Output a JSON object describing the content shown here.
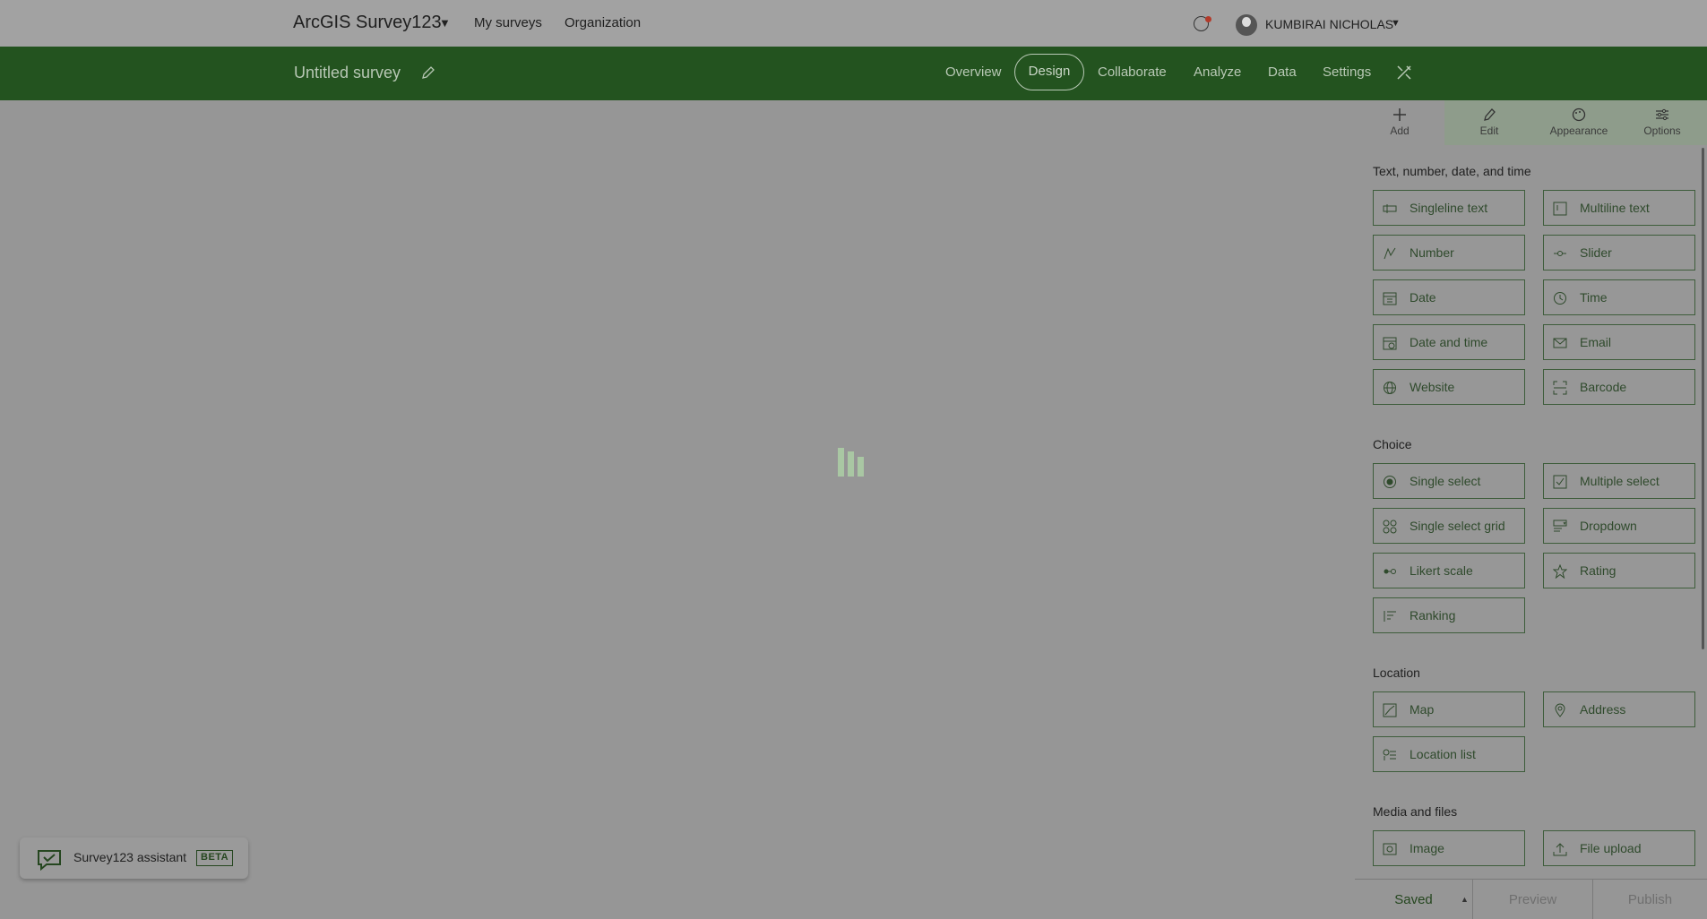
{
  "topbar": {
    "app_title": "ArcGIS Survey123",
    "nav": [
      "My surveys",
      "Organization"
    ],
    "user_name": "KUMBIRAI NICHOLAS"
  },
  "survey": {
    "title": "Untitled survey",
    "tabs": [
      "Overview",
      "Design",
      "Collaborate",
      "Analyze",
      "Data",
      "Settings"
    ],
    "active_tab": "Design"
  },
  "panel": {
    "tabs": [
      {
        "label": "Add",
        "icon": "plus-icon"
      },
      {
        "label": "Edit",
        "icon": "pencil-icon"
      },
      {
        "label": "Appearance",
        "icon": "palette-icon"
      },
      {
        "label": "Options",
        "icon": "sliders-icon"
      }
    ],
    "active_tab": "Edit",
    "sections": [
      {
        "title": "Text, number, date, and time",
        "items": [
          {
            "label": "Singleline text",
            "icon": "singleline-text-icon"
          },
          {
            "label": "Multiline text",
            "icon": "multiline-text-icon"
          },
          {
            "label": "Number",
            "icon": "number-icon"
          },
          {
            "label": "Slider",
            "icon": "slider-icon"
          },
          {
            "label": "Date",
            "icon": "calendar-icon"
          },
          {
            "label": "Time",
            "icon": "clock-icon"
          },
          {
            "label": "Date and time",
            "icon": "calendar-clock-icon"
          },
          {
            "label": "Email",
            "icon": "envelope-icon"
          },
          {
            "label": "Website",
            "icon": "globe-icon"
          },
          {
            "label": "Barcode",
            "icon": "barcode-icon"
          }
        ]
      },
      {
        "title": "Choice",
        "items": [
          {
            "label": "Single select",
            "icon": "radio-icon"
          },
          {
            "label": "Multiple select",
            "icon": "checkbox-icon"
          },
          {
            "label": "Single select grid",
            "icon": "grid-icon"
          },
          {
            "label": "Dropdown",
            "icon": "dropdown-icon"
          },
          {
            "label": "Likert scale",
            "icon": "likert-icon"
          },
          {
            "label": "Rating",
            "icon": "star-icon"
          },
          {
            "label": "Ranking",
            "icon": "ranking-icon"
          }
        ]
      },
      {
        "title": "Location",
        "items": [
          {
            "label": "Map",
            "icon": "map-icon"
          },
          {
            "label": "Address",
            "icon": "pin-icon"
          },
          {
            "label": "Location list",
            "icon": "location-list-icon"
          }
        ]
      },
      {
        "title": "Media and files",
        "items": [
          {
            "label": "Image",
            "icon": "image-icon"
          },
          {
            "label": "File upload",
            "icon": "upload-icon"
          }
        ]
      }
    ]
  },
  "bottom": {
    "saved": "Saved",
    "preview": "Preview",
    "publish": "Publish"
  },
  "assistant": {
    "label": "Survey123 assistant",
    "badge": "BETA"
  },
  "colors": {
    "brand_green": "#23531f",
    "overlay_gray": "#969696",
    "loader": "#a9c7a3"
  }
}
